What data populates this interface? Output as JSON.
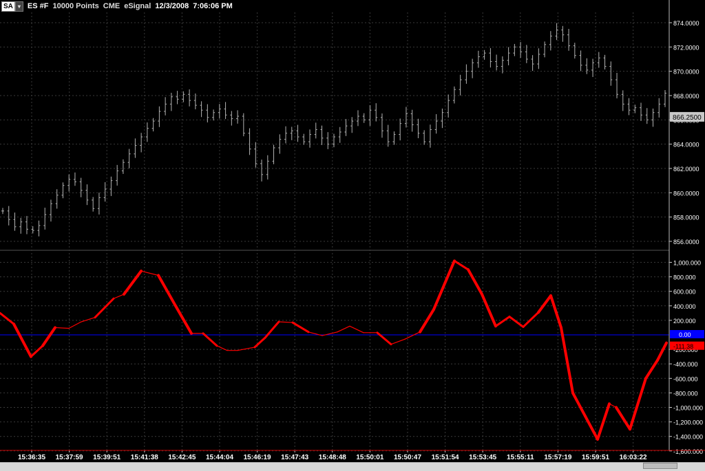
{
  "header": {
    "symbol_button": "SA",
    "symbol": "ES #F",
    "interval": "10000 Points",
    "exchange": "CME",
    "feed": "eSignal",
    "date": "12/3/2008",
    "time": "7:06:06 PM"
  },
  "colors": {
    "background": "#000000",
    "price_bars": "#b4b4b4",
    "grid": "#3a3a3a",
    "oscillator": "#ff0000",
    "zero_line": "#0000ff",
    "axis_text": "#ffffff"
  },
  "chart_data": [
    {
      "type": "line",
      "subtype": "ohlc-bars",
      "series_label": "ES #F 10000 Points",
      "last_value_label": "866.2500",
      "ylim": [
        855,
        875
      ],
      "yticks": [
        "856.0000",
        "858.0000",
        "860.0000",
        "862.0000",
        "864.0000",
        "866.0000",
        "868.0000",
        "870.0000",
        "872.0000",
        "874.0000"
      ],
      "bars": [
        858.5,
        857.8,
        857.2,
        857.6,
        857.0,
        856.9,
        857.3,
        858.2,
        859.1,
        859.8,
        860.6,
        861.1,
        860.9,
        860.2,
        859.4,
        858.7,
        859.6,
        860.3,
        861.0,
        861.8,
        862.5,
        863.2,
        863.9,
        864.6,
        865.3,
        865.9,
        866.7,
        867.3,
        867.9,
        867.7,
        868.1,
        867.6,
        867.2,
        866.8,
        866.2,
        866.6,
        866.9,
        866.4,
        866.1,
        866.3,
        864.9,
        863.6,
        862.4,
        861.5,
        862.6,
        863.7,
        864.4,
        864.9,
        865.1,
        864.6,
        864.2,
        864.8,
        865.2,
        864.5,
        864.0,
        864.6,
        865.0,
        865.5,
        865.9,
        866.3,
        866.0,
        866.8,
        866.2,
        865.1,
        864.2,
        864.8,
        865.7,
        866.5,
        865.6,
        864.9,
        864.2,
        865.2,
        865.9,
        866.6,
        867.6,
        868.5,
        869.3,
        870.0,
        870.7,
        871.2,
        871.5,
        870.8,
        870.4,
        870.9,
        871.5,
        872.0,
        871.6,
        871.0,
        870.6,
        871.4,
        872.2,
        872.9,
        873.4,
        873.0,
        872.1,
        871.3,
        870.5,
        870.1,
        870.7,
        871.1,
        870.4,
        869.3,
        868.1,
        867.3,
        866.8,
        867.0,
        866.4,
        866.0,
        866.6,
        867.3,
        868.2
      ]
    },
    {
      "type": "line",
      "subtype": "oscillator",
      "series_label": "Oscillator",
      "ylim": [
        -1600,
        1100
      ],
      "yticks": [
        "1,000.000",
        "800.000",
        "600.000",
        "400.000",
        "200.000",
        "-200.000",
        "-400.000",
        "-600.000",
        "-800.000",
        "-1,000.000",
        "-1,200.000",
        "-1,400.000",
        "-1,600.000"
      ],
      "ytick_values": [
        1000,
        800,
        600,
        400,
        200,
        -200,
        -400,
        -600,
        -800,
        -1000,
        -1200,
        -1400,
        -1600
      ],
      "zero_label": "0.00",
      "last_value_label": "-111.38",
      "points": [
        [
          0,
          300
        ],
        [
          20,
          150
        ],
        [
          45,
          -300
        ],
        [
          62,
          -150
        ],
        [
          80,
          100
        ],
        [
          100,
          90
        ],
        [
          118,
          180
        ],
        [
          138,
          240
        ],
        [
          165,
          500
        ],
        [
          180,
          560
        ],
        [
          205,
          880
        ],
        [
          230,
          820
        ],
        [
          255,
          400
        ],
        [
          278,
          20
        ],
        [
          295,
          20
        ],
        [
          315,
          -150
        ],
        [
          330,
          -215
        ],
        [
          345,
          -215
        ],
        [
          370,
          -170
        ],
        [
          385,
          -40
        ],
        [
          405,
          180
        ],
        [
          425,
          170
        ],
        [
          448,
          40
        ],
        [
          468,
          -10
        ],
        [
          490,
          40
        ],
        [
          508,
          120
        ],
        [
          528,
          30
        ],
        [
          548,
          30
        ],
        [
          568,
          -130
        ],
        [
          588,
          -60
        ],
        [
          610,
          40
        ],
        [
          630,
          350
        ],
        [
          660,
          1020
        ],
        [
          680,
          900
        ],
        [
          700,
          560
        ],
        [
          720,
          120
        ],
        [
          740,
          250
        ],
        [
          760,
          110
        ],
        [
          782,
          310
        ],
        [
          800,
          540
        ],
        [
          815,
          100
        ],
        [
          832,
          -800
        ],
        [
          850,
          -1120
        ],
        [
          868,
          -1440
        ],
        [
          885,
          -950
        ],
        [
          895,
          -1000
        ],
        [
          915,
          -1300
        ],
        [
          938,
          -600
        ],
        [
          955,
          -350
        ],
        [
          968,
          -111
        ]
      ]
    }
  ],
  "x_axis": {
    "labels": [
      "15:36:35",
      "15:37:59",
      "15:39:51",
      "15:41:38",
      "15:42:45",
      "15:44:04",
      "15:46:19",
      "15:47:43",
      "15:48:48",
      "15:50:01",
      "15:50:47",
      "15:51:54",
      "15:53:45",
      "15:55:11",
      "15:57:19",
      "15:59:51",
      "16:03:22"
    ]
  }
}
